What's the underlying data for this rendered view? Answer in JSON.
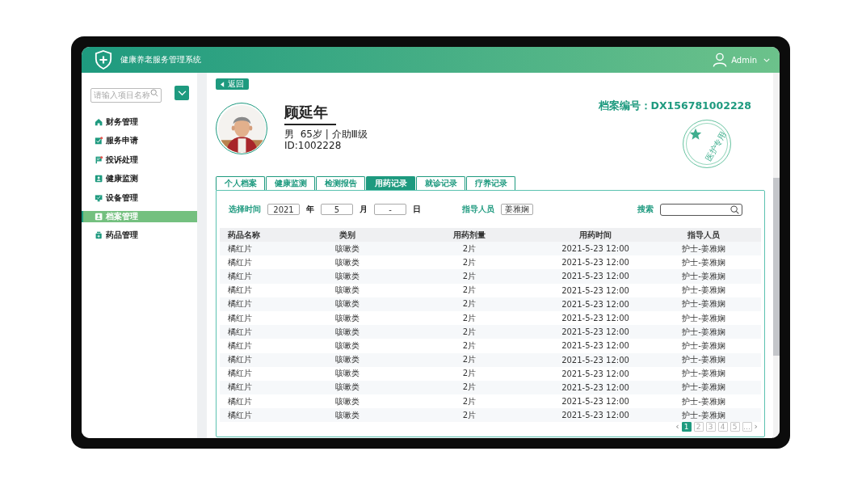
{
  "header": {
    "title": "健康养老服务管理系统",
    "user": "Admin"
  },
  "sidebar": {
    "search": {
      "placeholder": "请输入项目名称"
    },
    "items": [
      {
        "label": "财务管理",
        "alert": false,
        "selected": false
      },
      {
        "label": "服务申请",
        "alert": true,
        "selected": false
      },
      {
        "label": "投诉处理",
        "alert": true,
        "selected": false
      },
      {
        "label": "健康监测",
        "alert": false,
        "selected": false
      },
      {
        "label": "设备管理",
        "alert": false,
        "selected": false
      },
      {
        "label": "档案管理",
        "alert": false,
        "selected": true
      },
      {
        "label": "药品管理",
        "alert": false,
        "selected": false
      }
    ]
  },
  "back_button": "返回",
  "profile": {
    "name": "顾延年",
    "info": "男  65岁 | 介助Ⅲ级",
    "id": "ID:1002228",
    "file_number": "档案编号：DX156781002228",
    "stamp": "医护专用"
  },
  "tabs": [
    {
      "label": "个人档案",
      "selected": false
    },
    {
      "label": "健康监测",
      "selected": false
    },
    {
      "label": "检测报告",
      "selected": false
    },
    {
      "label": "用药记录",
      "selected": true
    },
    {
      "label": "就诊记录",
      "selected": false
    },
    {
      "label": "疗养记录",
      "selected": false
    }
  ],
  "filters": {
    "time_label": "选择时间",
    "year": "2021",
    "year_unit": "年",
    "month": "5",
    "month_unit": "月",
    "day": "-",
    "day_unit": "日",
    "staff_label": "指导人员",
    "staff": "姜雅娴",
    "search_label": "搜索"
  },
  "table": {
    "columns": [
      "药品名称",
      "类别",
      "用药剂量",
      "用药时间",
      "指导人员"
    ],
    "rows": [
      [
        "橘红片",
        "咳嗽类",
        "2片",
        "2021-5-23 12:00",
        "护士-姜雅娴"
      ],
      [
        "橘红片",
        "咳嗽类",
        "2片",
        "2021-5-23 12:00",
        "护士-姜雅娴"
      ],
      [
        "橘红片",
        "咳嗽类",
        "2片",
        "2021-5-23 12:00",
        "护士-姜雅娴"
      ],
      [
        "橘红片",
        "咳嗽类",
        "2片",
        "2021-5-23 12:00",
        "护士-姜雅娴"
      ],
      [
        "橘红片",
        "咳嗽类",
        "2片",
        "2021-5-23 12:00",
        "护士-姜雅娴"
      ],
      [
        "橘红片",
        "咳嗽类",
        "2片",
        "2021-5-23 12:00",
        "护士-姜雅娴"
      ],
      [
        "橘红片",
        "咳嗽类",
        "2片",
        "2021-5-23 12:00",
        "护士-姜雅娴"
      ],
      [
        "橘红片",
        "咳嗽类",
        "2片",
        "2021-5-23 12:00",
        "护士-姜雅娴"
      ],
      [
        "橘红片",
        "咳嗽类",
        "2片",
        "2021-5-23 12:00",
        "护士-姜雅娴"
      ],
      [
        "橘红片",
        "咳嗽类",
        "2片",
        "2021-5-23 12:00",
        "护士-姜雅娴"
      ],
      [
        "橘红片",
        "咳嗽类",
        "2片",
        "2021-5-23 12:00",
        "护士-姜雅娴"
      ],
      [
        "橘红片",
        "咳嗽类",
        "2片",
        "2021-5-23 12:00",
        "护士-姜雅娴"
      ],
      [
        "橘红片",
        "咳嗽类",
        "2片",
        "2021-5-23 12:00",
        "护士-姜雅娴"
      ]
    ]
  },
  "pagination": {
    "prev": "‹",
    "pages": [
      {
        "label": "1",
        "selected": true
      },
      {
        "label": "2",
        "selected": false
      },
      {
        "label": "3",
        "selected": false
      },
      {
        "label": "4",
        "selected": false
      },
      {
        "label": "5",
        "selected": false
      },
      {
        "label": "…",
        "selected": false
      }
    ],
    "next": "›"
  }
}
